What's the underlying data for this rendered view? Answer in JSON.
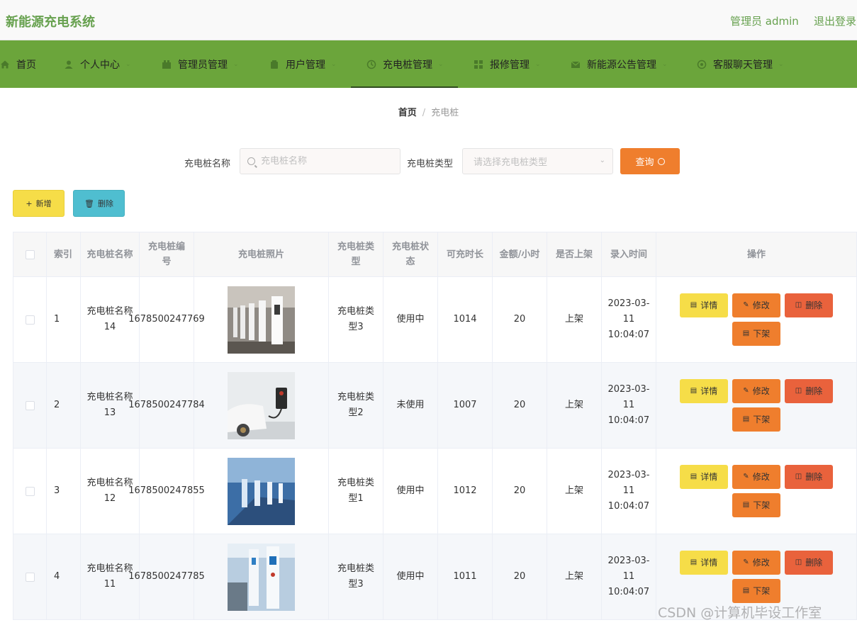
{
  "header": {
    "app_title": "新能源充电系统",
    "admin_label": "管理员 admin",
    "logout_label": "退出登录",
    "brand_color": "#67a14f"
  },
  "nav": {
    "active_color": "#6ba53b",
    "items": [
      {
        "label": "首页",
        "icon": "home-icon"
      },
      {
        "label": "个人中心",
        "icon": "user-icon"
      },
      {
        "label": "管理员管理",
        "icon": "admin-icon"
      },
      {
        "label": "用户管理",
        "icon": "users-icon"
      },
      {
        "label": "充电桩管理",
        "icon": "charger-icon"
      },
      {
        "label": "报修管理",
        "icon": "repair-icon"
      },
      {
        "label": "新能源公告管理",
        "icon": "notice-icon"
      },
      {
        "label": "客服聊天管理",
        "icon": "chat-icon"
      }
    ]
  },
  "breadcrumb": {
    "home": "首页",
    "separator": "/",
    "current": "充电桩"
  },
  "search": {
    "name_label": "充电桩名称",
    "name_placeholder": "充电桩名称",
    "type_label": "充电桩类型",
    "type_placeholder": "请选择充电桩类型",
    "query_label": "查询"
  },
  "toolbar": {
    "add_label": "新增",
    "delete_label": "删除"
  },
  "table": {
    "columns": [
      "索引",
      "充电桩名称",
      "充电桩编号",
      "充电桩照片",
      "充电桩类型",
      "充电桩状态",
      "可充时长",
      "金额/小时",
      "是否上架",
      "录入时间",
      "操作"
    ],
    "rows": [
      {
        "index": "1",
        "name": "充电桩名称14",
        "code": "1678500247769",
        "type": "充电桩类型3",
        "status": "使用中",
        "duration": "1014",
        "price": "20",
        "shelf": "上架",
        "time": "2023-03-11 10:04:07"
      },
      {
        "index": "2",
        "name": "充电桩名称13",
        "code": "1678500247784",
        "type": "充电桩类型2",
        "status": "未使用",
        "duration": "1007",
        "price": "20",
        "shelf": "上架",
        "time": "2023-03-11 10:04:07"
      },
      {
        "index": "3",
        "name": "充电桩名称12",
        "code": "1678500247855",
        "type": "充电桩类型1",
        "status": "使用中",
        "duration": "1012",
        "price": "20",
        "shelf": "上架",
        "time": "2023-03-11 10:04:07"
      },
      {
        "index": "4",
        "name": "充电桩名称11",
        "code": "1678500247785",
        "type": "充电桩类型3",
        "status": "使用中",
        "duration": "1011",
        "price": "20",
        "shelf": "上架",
        "time": "2023-03-11 10:04:07"
      }
    ],
    "actions": {
      "detail": "详情",
      "edit": "修改",
      "delete": "删除",
      "off_shelf": "下架"
    }
  },
  "watermark": "CSDN @计算机毕设工作室"
}
